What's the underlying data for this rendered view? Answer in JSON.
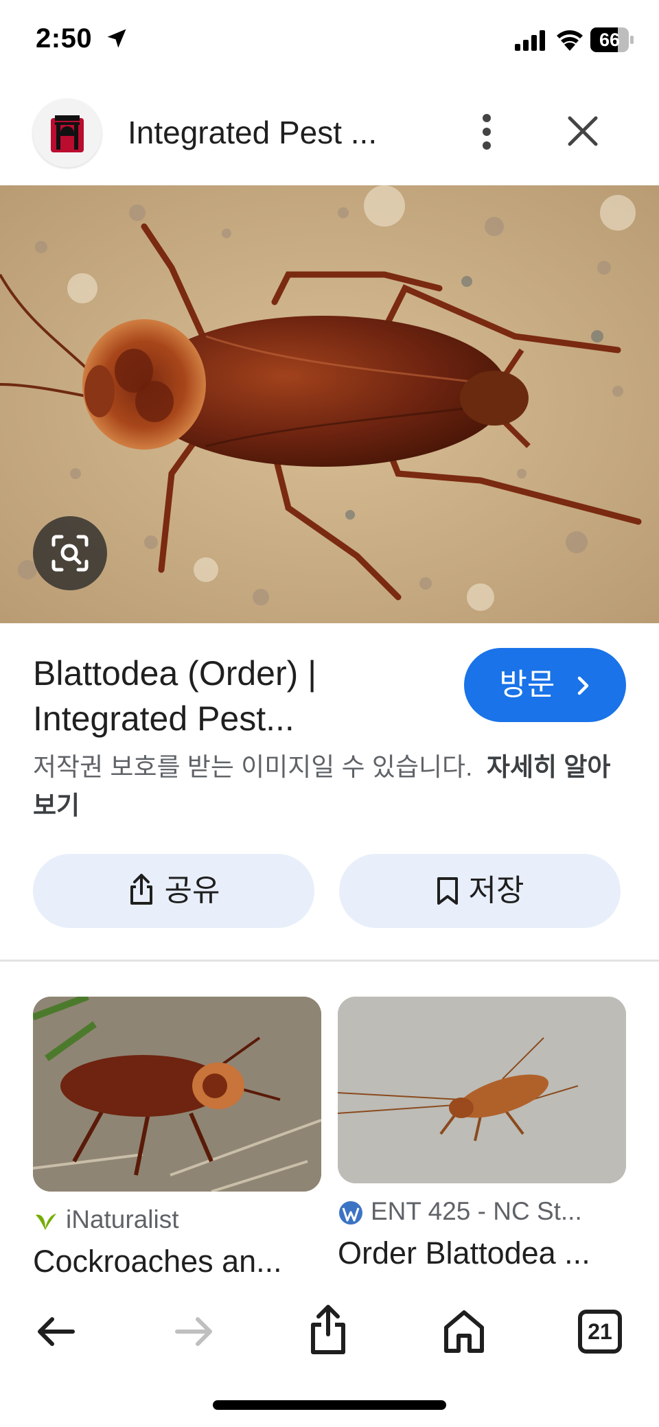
{
  "status_bar": {
    "time": "2:50",
    "battery": "66"
  },
  "header": {
    "title": "Integrated Pest ...",
    "favicon": "uga-arch-icon",
    "more_icon": "more-vert-icon",
    "close_icon": "close-icon"
  },
  "hero": {
    "description_icon": "lens-search-icon"
  },
  "result": {
    "title_line1": "Blattodea (Order) |",
    "title_line2": "Integrated Pest...",
    "visit_label": "방문",
    "copyright_text": "저작권 보호를 받는 이미지일 수 있습니다.",
    "learn_more": "자세히 알아보기"
  },
  "actions": {
    "share_label": "공유",
    "save_label": "저장"
  },
  "related": [
    {
      "source": "iNaturalist",
      "title": "Cockroaches an...",
      "icon": "inaturalist-leaf-icon"
    },
    {
      "source": "ENT 425 - NC St...",
      "title": "Order Blattodea ...",
      "icon": "wordpress-icon"
    }
  ],
  "toolbar": {
    "tab_count": "21"
  },
  "colors": {
    "accent": "#1a73e8",
    "pill_bg": "#e8effa",
    "text": "#1f1f1f",
    "muted": "#5f6368"
  }
}
